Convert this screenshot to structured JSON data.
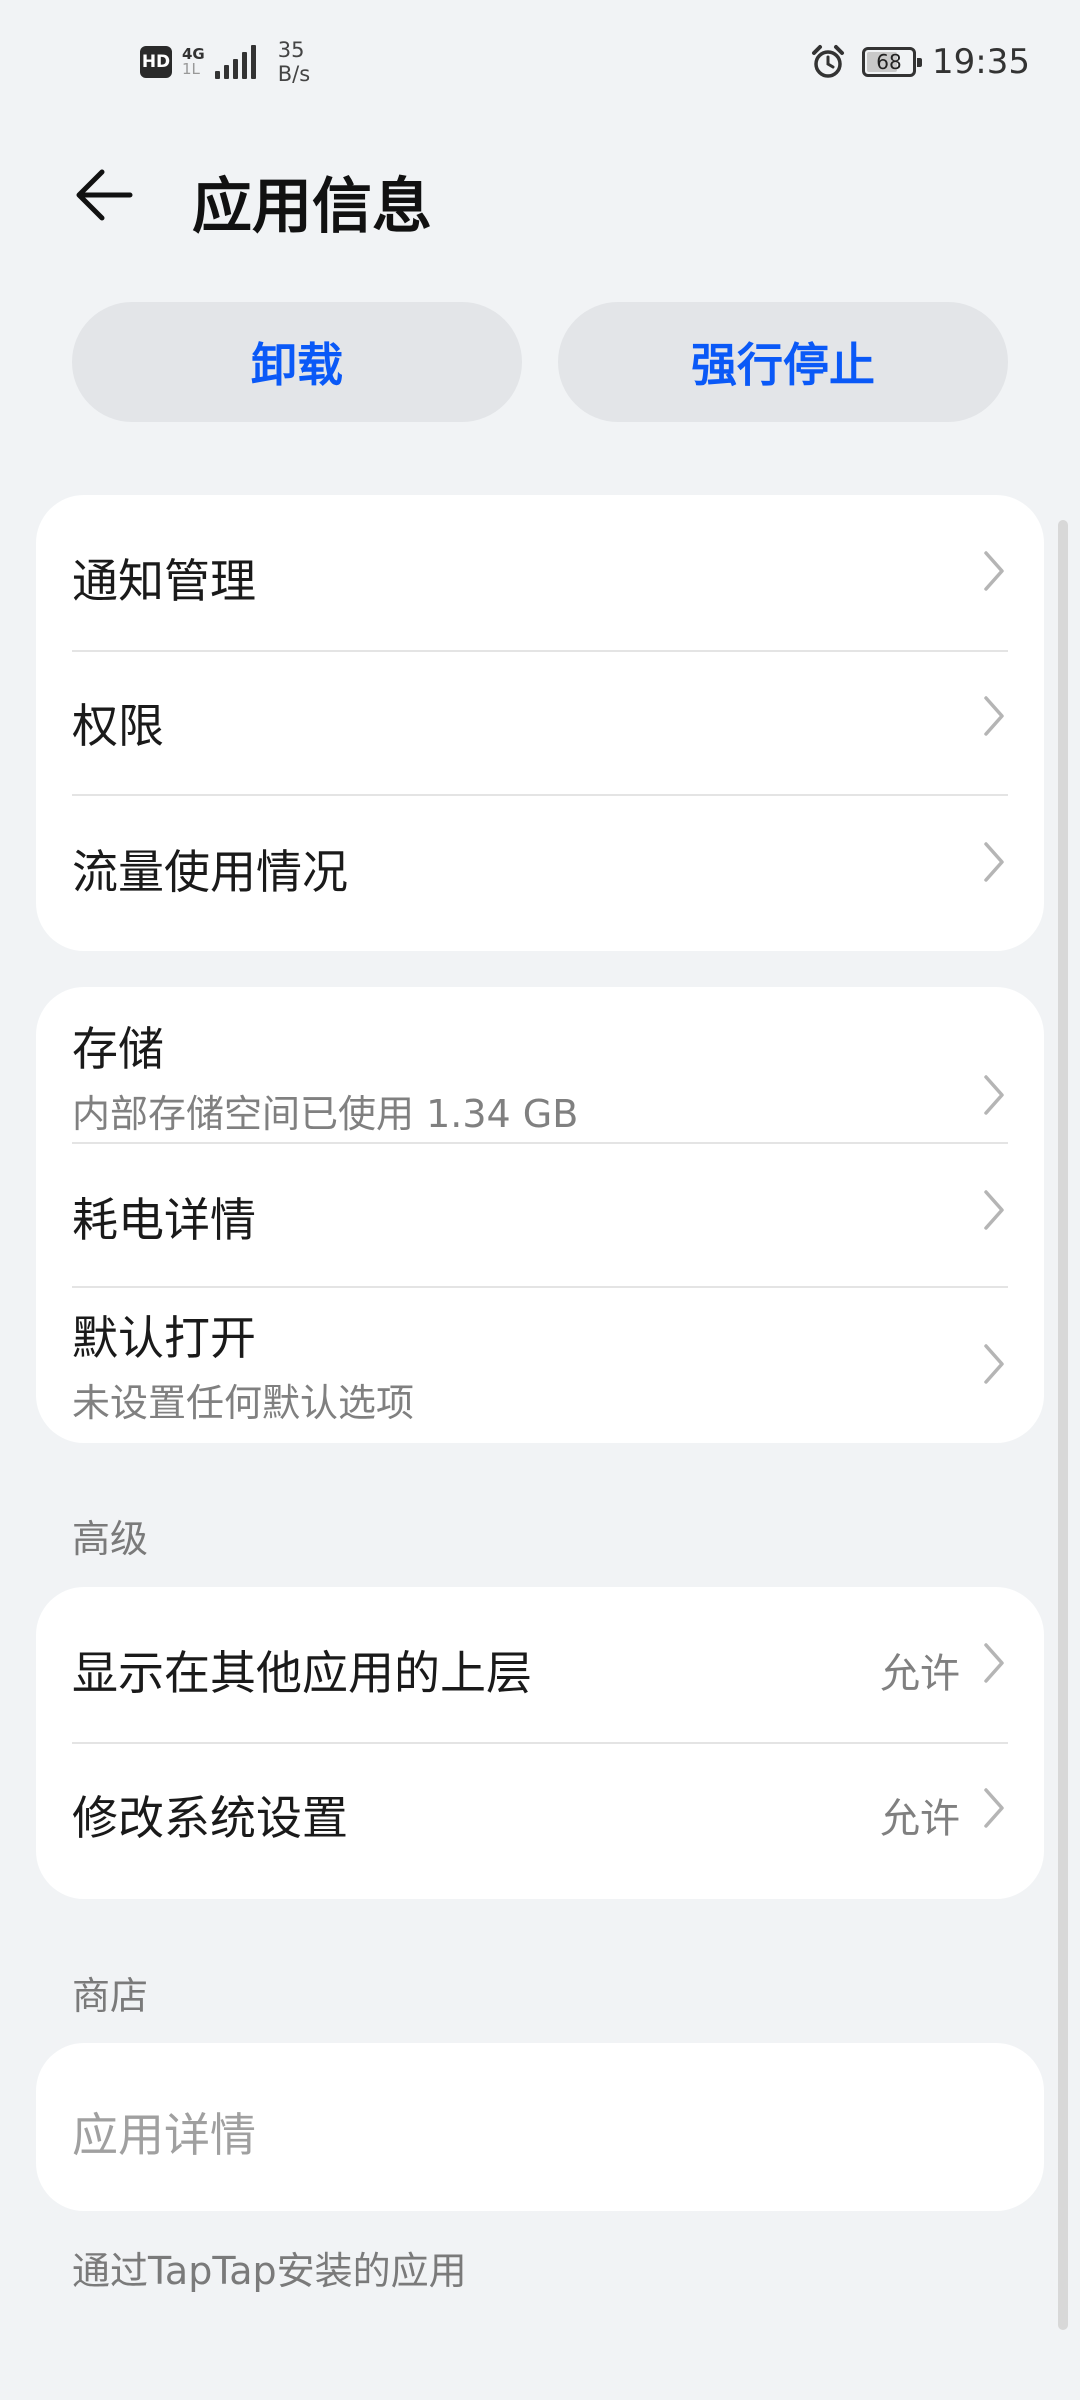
{
  "status_bar": {
    "hd": "HD",
    "net_type_top": "4G",
    "net_type_bottom": "1L",
    "speed_value": "35",
    "speed_unit": "B/s",
    "battery": "68",
    "battery_level": 0.68,
    "time": "19:35"
  },
  "header": {
    "title": "应用信息",
    "back_icon": "back-arrow-icon"
  },
  "actions": {
    "uninstall": "卸载",
    "force_stop": "强行停止",
    "accent_color": "#0a59f7"
  },
  "group1": {
    "items": [
      {
        "title": "通知管理"
      },
      {
        "title": "权限"
      },
      {
        "title": "流量使用情况"
      }
    ]
  },
  "group2": {
    "items": [
      {
        "title": "存储",
        "subtitle": "内部存储空间已使用 1.34 GB"
      },
      {
        "title": "耗电详情"
      },
      {
        "title": "默认打开",
        "subtitle": "未设置任何默认选项"
      }
    ]
  },
  "advanced": {
    "label": "高级",
    "items": [
      {
        "title": "显示在其他应用的上层",
        "value": "允许"
      },
      {
        "title": "修改系统设置",
        "value": "允许"
      }
    ]
  },
  "store": {
    "label": "商店",
    "item": "应用详情",
    "note": "通过TapTap安装的应用"
  }
}
